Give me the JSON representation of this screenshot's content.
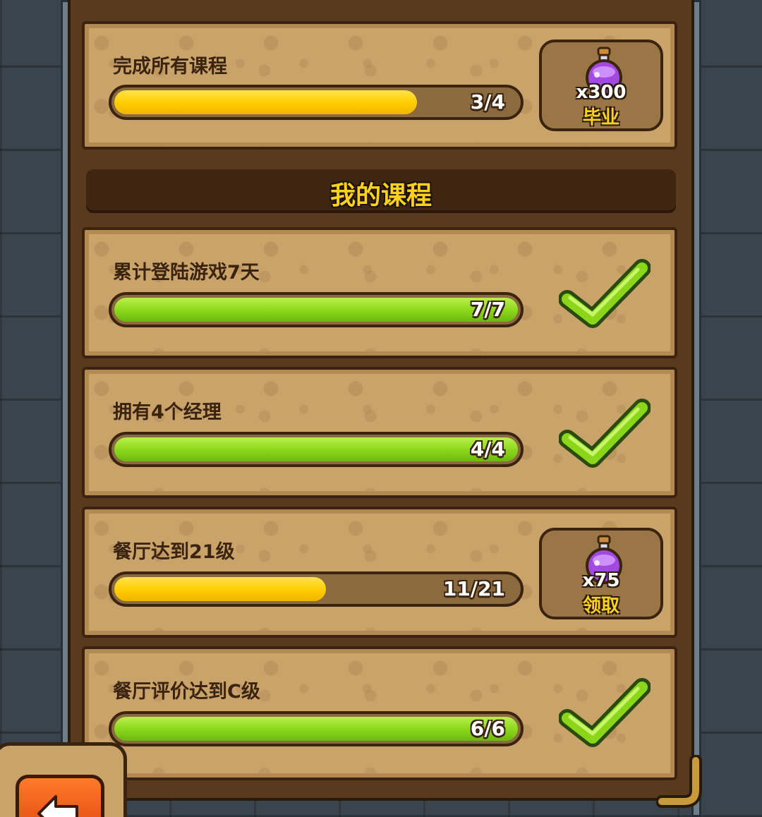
{
  "summary": {
    "title": "完成所有课程",
    "progress_text": "3/4",
    "progress_fraction": 0.75,
    "reward": {
      "count": "x300",
      "label": "毕业",
      "icon": "purple-potion-icon"
    }
  },
  "section": {
    "title": "我的课程"
  },
  "courses": [
    {
      "title": "累计登陆游戏7天",
      "progress_text": "7/7",
      "progress_fraction": 1.0,
      "status": "complete",
      "icon": "check-icon"
    },
    {
      "title": "拥有4个经理",
      "progress_text": "4/4",
      "progress_fraction": 1.0,
      "status": "complete",
      "icon": "check-icon"
    },
    {
      "title": "餐厅达到21级",
      "progress_text": "11/21",
      "progress_fraction": 0.524,
      "status": "claimable",
      "reward": {
        "count": "x75",
        "label": "领取",
        "icon": "purple-potion-icon"
      }
    },
    {
      "title": "餐厅评价达到C级",
      "progress_text": "6/6",
      "progress_fraction": 1.0,
      "status": "complete",
      "icon": "check-icon"
    }
  ],
  "colors": {
    "progress_yellow": "#ffcc00",
    "progress_green": "#8bd61a",
    "reward_label": "#ffd21a",
    "back_button": "#e24a10"
  },
  "back_button": {
    "icon": "back-arrow-icon"
  }
}
